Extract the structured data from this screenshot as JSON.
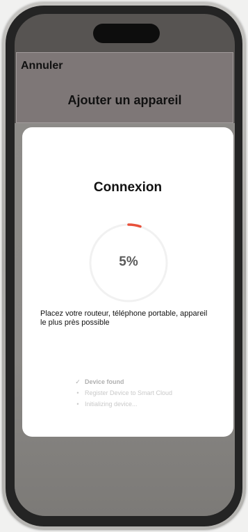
{
  "header": {
    "cancel_label": "Annuler",
    "title": "Ajouter un appareil"
  },
  "modal": {
    "title": "Connexion",
    "progress": {
      "percent": 5,
      "label": "5%"
    },
    "instruction": "Placez votre routeur, téléphone portable, appareil le plus près possible",
    "steps": [
      {
        "icon": "check-icon",
        "glyph": "✓",
        "label": "Device found"
      },
      {
        "icon": "bullet-icon",
        "glyph": "•",
        "label": "Register Device to Smart Cloud"
      },
      {
        "icon": "bullet-icon",
        "glyph": "•",
        "label": "Initializing device..."
      }
    ]
  },
  "colors": {
    "progress_accent": "#e8503a",
    "progress_track": "#f1f1f1",
    "header_background": "#7e7777",
    "overlay": "#8b8986",
    "modal_background": "#ffffff"
  }
}
